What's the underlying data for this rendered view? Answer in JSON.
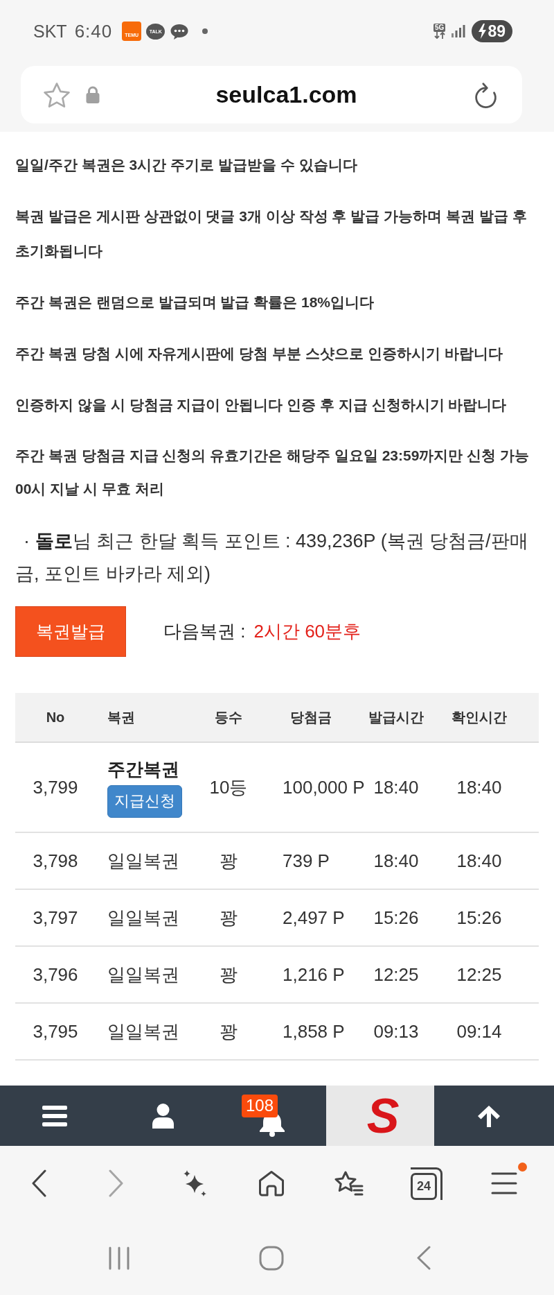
{
  "status_bar": {
    "carrier": "SKT",
    "time": "6:40",
    "notifications": [
      {
        "kind": "tile",
        "label": "TEMU"
      },
      {
        "kind": "bubble",
        "label": "TALK"
      },
      {
        "kind": "chat"
      },
      {
        "kind": "dot"
      }
    ],
    "network": "5G",
    "battery": "89",
    "charging": true
  },
  "address_bar": {
    "url": "seulca1.com"
  },
  "notices": [
    "일일/주간 복권은 3시간 주기로 발급받을 수 있습니다",
    "복권 발급은 게시판 상관없이 댓글 3개 이상 작성 후 발급 가능하며 복권 발급 후 초기화됩니다",
    "주간 복권은 랜덤으로 발급되며 발급 확률은 18%입니다",
    "주간 복권 당첨 시에 자유게시판에 당첨 부분 스샷으로 인증하시기 바랍니다",
    "인증하지 않을 시 당첨금 지급이 안됩니다 인증 후 지급 신청하시기 바랍니다",
    "주간 복권 당첨금 지급 신청의 유효기간은 해당주 일요일 23:59까지만 신청 가능 00시 지날 시 무효 처리"
  ],
  "points_summary": "· **돌로**님 최근 한달 획득 포인트 : 439,236P (복권 당첨금/판매금, 포인트 바카라 제외)",
  "issue_button": "복권발급",
  "next_ticket": {
    "label": "다음복권 :",
    "value": "2시간 60분후"
  },
  "table": {
    "columns": [
      "No",
      "복권",
      "등수",
      "당첨금",
      "발급시간",
      "확인시간"
    ],
    "rows": [
      {
        "kind": "weekly",
        "no": "3,799",
        "ticket": "주간복권",
        "action": "지급신청",
        "rank": "10등",
        "prize": "100,000 P",
        "issued_time": "18:40",
        "confirmed_time": "18:40"
      },
      {
        "kind": "daily",
        "no": "3,798",
        "ticket": "일일복권",
        "rank": "꽝",
        "prize": "739 P",
        "issued_time": "18:40",
        "confirmed_time": "18:40"
      },
      {
        "kind": "daily",
        "no": "3,797",
        "ticket": "일일복권",
        "rank": "꽝",
        "prize": "2,497 P",
        "issued_time": "15:26",
        "confirmed_time": "15:26"
      },
      {
        "kind": "daily",
        "no": "3,796",
        "ticket": "일일복권",
        "rank": "꽝",
        "prize": "1,216 P",
        "issued_time": "12:25",
        "confirmed_time": "12:25"
      },
      {
        "kind": "daily",
        "no": "3,795",
        "ticket": "일일복권",
        "rank": "꽝",
        "prize": "1,858 P",
        "issued_time": "09:13",
        "confirmed_time": "09:14"
      }
    ]
  },
  "bottom_nav": [
    {
      "kind": "menu"
    },
    {
      "kind": "user"
    },
    {
      "kind": "bell",
      "badge": "108"
    },
    {
      "kind": "logo",
      "label": "S"
    },
    {
      "kind": "top"
    }
  ],
  "browser_toolbar": [
    {
      "kind": "back",
      "disabled": false,
      "alert": false
    },
    {
      "kind": "forward",
      "disabled": true,
      "alert": false
    },
    {
      "kind": "assistant",
      "disabled": false,
      "alert": false
    },
    {
      "kind": "home",
      "disabled": false,
      "alert": false
    },
    {
      "kind": "bookmarks",
      "disabled": false,
      "alert": false
    },
    {
      "kind": "tabs",
      "count": "24",
      "disabled": false,
      "alert": false
    },
    {
      "kind": "menu",
      "disabled": false,
      "alert": true
    }
  ],
  "system_nav": [
    {
      "kind": "recents"
    },
    {
      "kind": "home"
    },
    {
      "kind": "back"
    }
  ]
}
